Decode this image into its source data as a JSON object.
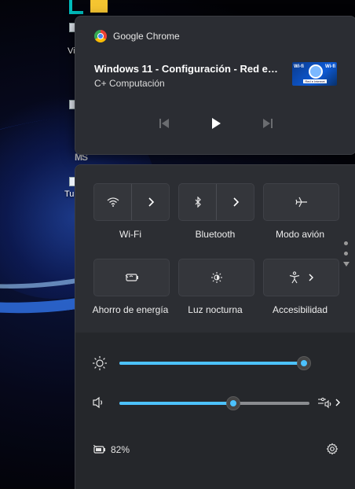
{
  "media": {
    "app_name": "Google Chrome",
    "title": "Windows 11 - Configuración - Red e…",
    "subtitle": "C+ Computación",
    "thumbnail": {
      "left_text": "Wi-fi",
      "right_text": "Wi-fi",
      "band_text": "Red e Internet"
    }
  },
  "desktop": {
    "labels": [
      "Vi",
      "Tu"
    ],
    "logo_text": "MS"
  },
  "quick_settings": {
    "tiles": [
      {
        "label": "Wi-Fi",
        "icon": "wifi-icon",
        "split": true
      },
      {
        "label": "Bluetooth",
        "icon": "bluetooth-icon",
        "split": true
      },
      {
        "label": "Modo avión",
        "icon": "airplane-icon",
        "split": false
      },
      {
        "label": "Ahorro de energía",
        "icon": "battery-saver-icon",
        "split": false
      },
      {
        "label": "Luz nocturna",
        "icon": "night-light-icon",
        "split": false
      },
      {
        "label": "Accesibilidad",
        "icon": "accessibility-icon",
        "split": false
      }
    ],
    "brightness_level": 1.0,
    "volume_level": 0.6,
    "battery_text": "82%"
  },
  "colors": {
    "accent": "#4cc2ff",
    "panel": "#25272b",
    "tile": "#34363b"
  }
}
